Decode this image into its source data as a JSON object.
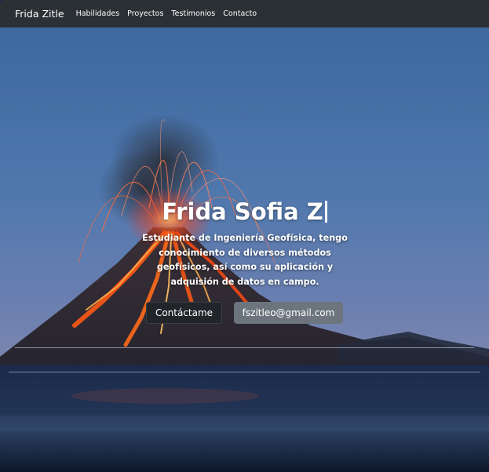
{
  "navbar": {
    "brand": "Frida Zitle",
    "links": [
      "Habilidades",
      "Proyectos",
      "Testimonios",
      "Contacto"
    ]
  },
  "hero": {
    "title": "Frida Sofia Z",
    "description": "Estudiante de Ingeniería Geofísica, tengo conocimiento de diversos métodos geofísicos, así como su aplicación y adquisión de datos en campo.",
    "contact_button": "Contáctame",
    "email_button": "fszitleo@gmail.com",
    "background": "volcano-eruption-image"
  },
  "colors": {
    "navbar_bg": "#2b3035",
    "sky_top": "#3f6aa3",
    "lava": "#ff5a14",
    "btn_dark": "#212529",
    "btn_gray": "#6c757d"
  }
}
